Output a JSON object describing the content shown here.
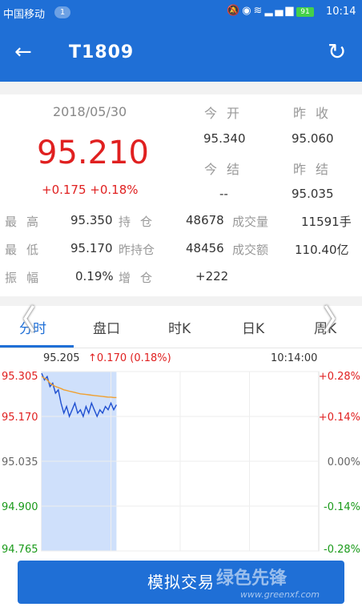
{
  "status_bar": {
    "carrier": "中国移动",
    "notification_count": "1",
    "battery": "91",
    "time": "10:14",
    "network": "4G"
  },
  "header": {
    "title": "T1809",
    "back_icon": "arrow-left-icon",
    "refresh_icon": "refresh-icon"
  },
  "quote": {
    "date": "2018/05/30",
    "price": "95.210",
    "change": "+0.175 +0.18%",
    "today_open_label": "今开",
    "today_open": "95.340",
    "prev_close_label": "昨收",
    "prev_close": "95.060",
    "today_settle_label": "今结",
    "today_settle": "--",
    "prev_settle_label": "昨结",
    "prev_settle": "95.035",
    "price_color": "#e02020"
  },
  "stats": {
    "high_label": "最高",
    "high": "95.350",
    "position_label": "持仓",
    "position": "48678",
    "volume_label": "成交量",
    "volume": "11591手",
    "low_label": "最低",
    "low": "95.170",
    "prev_position_label": "昨持仓",
    "prev_position": "48456",
    "turnover_label": "成交额",
    "turnover": "110.40亿",
    "amplitude_label": "振幅",
    "amplitude": "0.19%",
    "increase_label": "增仓",
    "increase": "+222"
  },
  "tabs": [
    {
      "label": "分时",
      "active": true
    },
    {
      "label": "盘口",
      "active": false
    },
    {
      "label": "时K",
      "active": false
    },
    {
      "label": "日K",
      "active": false
    },
    {
      "label": "周K",
      "active": false
    }
  ],
  "chart_data": {
    "type": "line",
    "current_price": "95.205",
    "change_text": "↑0.170 (0.18%)",
    "time_label": "10:14:00",
    "y_left_ticks": [
      "95.305",
      "95.170",
      "95.035",
      "94.900",
      "94.765"
    ],
    "y_right_ticks": [
      "+0.28%",
      "+0.14%",
      "0.00%",
      "-0.14%",
      "-0.28%"
    ],
    "ylim": [
      94.765,
      95.305
    ],
    "baseline": 95.035,
    "grid": true,
    "series": [
      {
        "role": "price",
        "color": "#1f4fd0",
        "values": [
          95.3,
          95.28,
          95.29,
          95.26,
          95.27,
          95.24,
          95.25,
          95.21,
          95.18,
          95.2,
          95.17,
          95.19,
          95.21,
          95.18,
          95.19,
          95.17,
          95.2,
          95.18,
          95.21,
          95.19,
          95.17,
          95.19,
          95.18,
          95.2,
          95.19,
          95.21,
          95.19,
          95.205
        ]
      },
      {
        "role": "average",
        "color": "#f0a030",
        "values": [
          95.29,
          95.285,
          95.28,
          95.27,
          95.265,
          95.26,
          95.257,
          95.254,
          95.25,
          95.248,
          95.246,
          95.244,
          95.242,
          95.24,
          95.238,
          95.237,
          95.236,
          95.235,
          95.234,
          95.233,
          95.232,
          95.231,
          95.23,
          95.229,
          95.228,
          95.228,
          95.227,
          95.227
        ]
      }
    ],
    "session_fraction": 0.27,
    "up_color": "#e02020",
    "down_color": "#1a9a1a"
  },
  "cta": {
    "label": "模拟交易"
  },
  "watermark": {
    "text": "绿色先锋",
    "url": "www.greenxf.com"
  }
}
